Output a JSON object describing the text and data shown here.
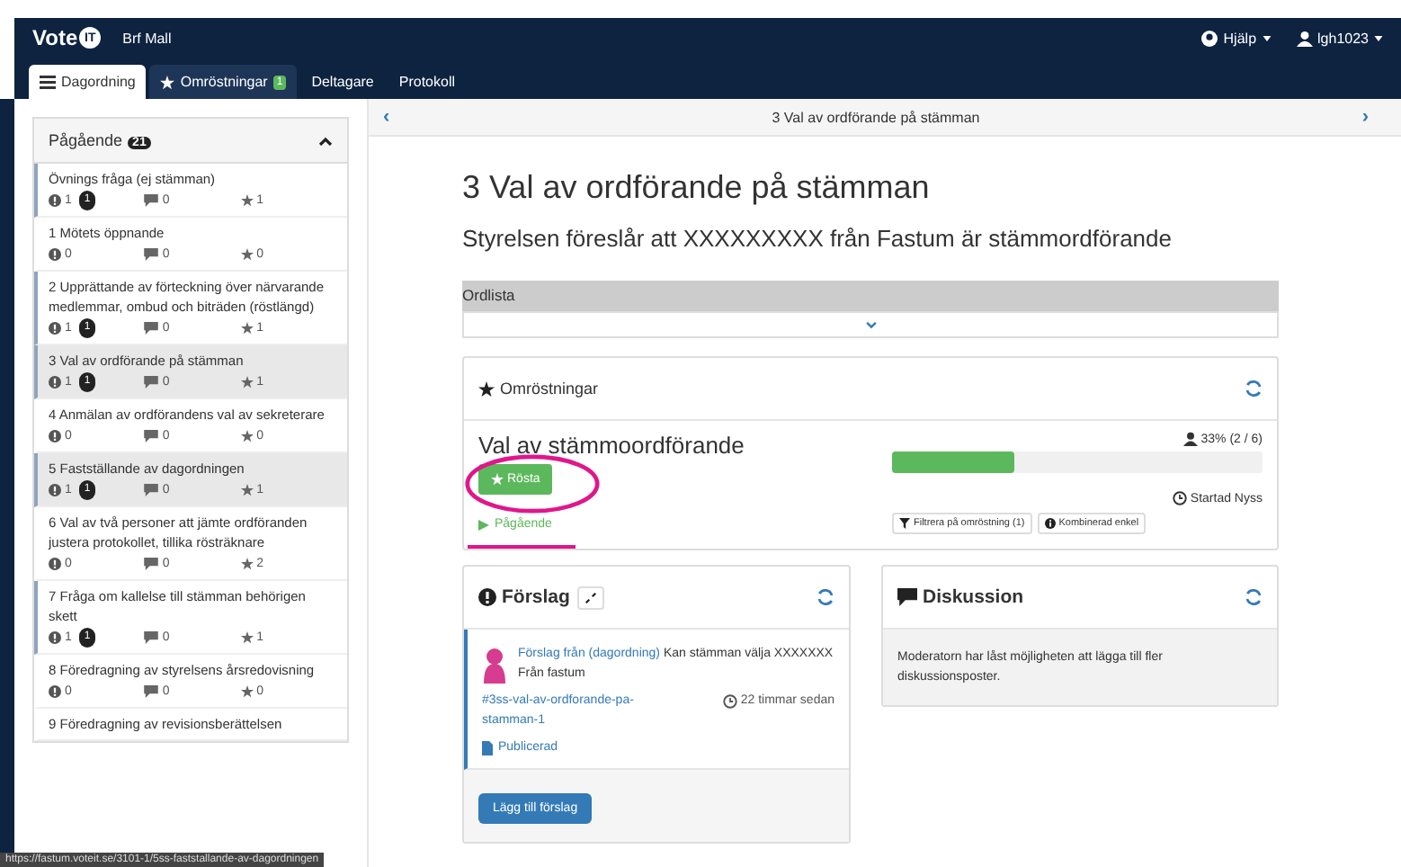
{
  "brand": {
    "logo": "Vote",
    "logo_mark": "IT",
    "org": "Brf Mall"
  },
  "user_menu": [
    {
      "label": "Hjälp"
    },
    {
      "label": "lgh1023"
    }
  ],
  "tabs": [
    {
      "label": "Dagordning",
      "selected": true
    },
    {
      "label": "Omröstningar",
      "badge": "1",
      "selected": false
    },
    {
      "label": "Deltagare",
      "selected": false
    },
    {
      "label": "Protokoll",
      "selected": false
    }
  ],
  "sidebar": {
    "title": "Pågående",
    "count": "21",
    "expanded": true,
    "items": [
      {
        "title": "Övnings fråga (ej stämman)",
        "proposals": "1",
        "unread": "1",
        "discussions": "0",
        "likes": "1",
        "marked": true,
        "highlighted": false
      },
      {
        "title": "1 Mötets öppnande",
        "proposals": "0",
        "discussions": "0",
        "likes": "0",
        "marked": false,
        "highlighted": false
      },
      {
        "title": "2 Upprättande av förteckning över närvarande medlemmar, ombud och biträden (röstlängd)",
        "proposals": "1",
        "unread": "1",
        "discussions": "0",
        "likes": "1",
        "marked": true,
        "highlighted": false
      },
      {
        "title": "3 Val av ordförande på stämman",
        "proposals": "1",
        "unread": "1",
        "discussions": "0",
        "likes": "1",
        "marked": true,
        "highlighted": true
      },
      {
        "title": "4 Anmälan av ordförandens val av sekreterare",
        "proposals": "0",
        "discussions": "0",
        "likes": "0",
        "marked": false,
        "highlighted": false
      },
      {
        "title": "5 Fastställande av dagordningen",
        "proposals": "1",
        "unread": "1",
        "discussions": "0",
        "likes": "1",
        "marked": true,
        "highlighted": true
      },
      {
        "title": "6 Val av två personer att jämte ordföranden justera protokollet, tillika rösträknare",
        "proposals": "0",
        "discussions": "0",
        "likes": "2",
        "marked": false,
        "highlighted": false
      },
      {
        "title": "7 Fråga om kallelse till stämman behörigen skett",
        "proposals": "1",
        "unread": "1",
        "discussions": "0",
        "likes": "1",
        "marked": true,
        "highlighted": false
      },
      {
        "title": "8 Föredragning av styrelsens årsredovisning",
        "proposals": "0",
        "discussions": "0",
        "likes": "0",
        "marked": false,
        "highlighted": false
      },
      {
        "title": "9 Föredragning av revisionsberättelsen",
        "marked": false,
        "highlighted": false
      }
    ]
  },
  "pager": {
    "prev": "‹",
    "title": "3 Val av ordförande på stämman",
    "next": "›"
  },
  "heading": "3 Val av ordförande på stämman",
  "subheading": "Styrelsen föreslår att XXXXXXXXX från Fastum är stämmordförande",
  "glossary": {
    "label": "Ordlista"
  },
  "polls": {
    "title": "Omröstningar",
    "poll": {
      "title": "Val av stämmoordförande",
      "vote_button": "Rösta",
      "status": "Pågående",
      "participation": "33% (2 / 6)",
      "level": 0.33,
      "started": "Startad Nyss",
      "filter_button": "Filtrera på omröstning (1)",
      "method_button": "Kombinerad enkel"
    }
  },
  "proposals": {
    "title": "Förslag",
    "items": [
      {
        "author_link": "Förslag från (dagordning)",
        "text": "Kan stämman välja XXXXXXX Från fastum",
        "tag": "#3ss-val-av-ordforande-pa-stamman-1",
        "time": "22 timmar sedan",
        "state": "Publicerad"
      }
    ],
    "add_button": "Lägg till förslag"
  },
  "discussion": {
    "title": "Diskussion",
    "message": "Moderatorn har låst möjligheten att lägga till fler diskussionsposter."
  },
  "status_url": "https://fastum.voteit.se/3101-1/5ss-faststallande-av-dagordningen"
}
